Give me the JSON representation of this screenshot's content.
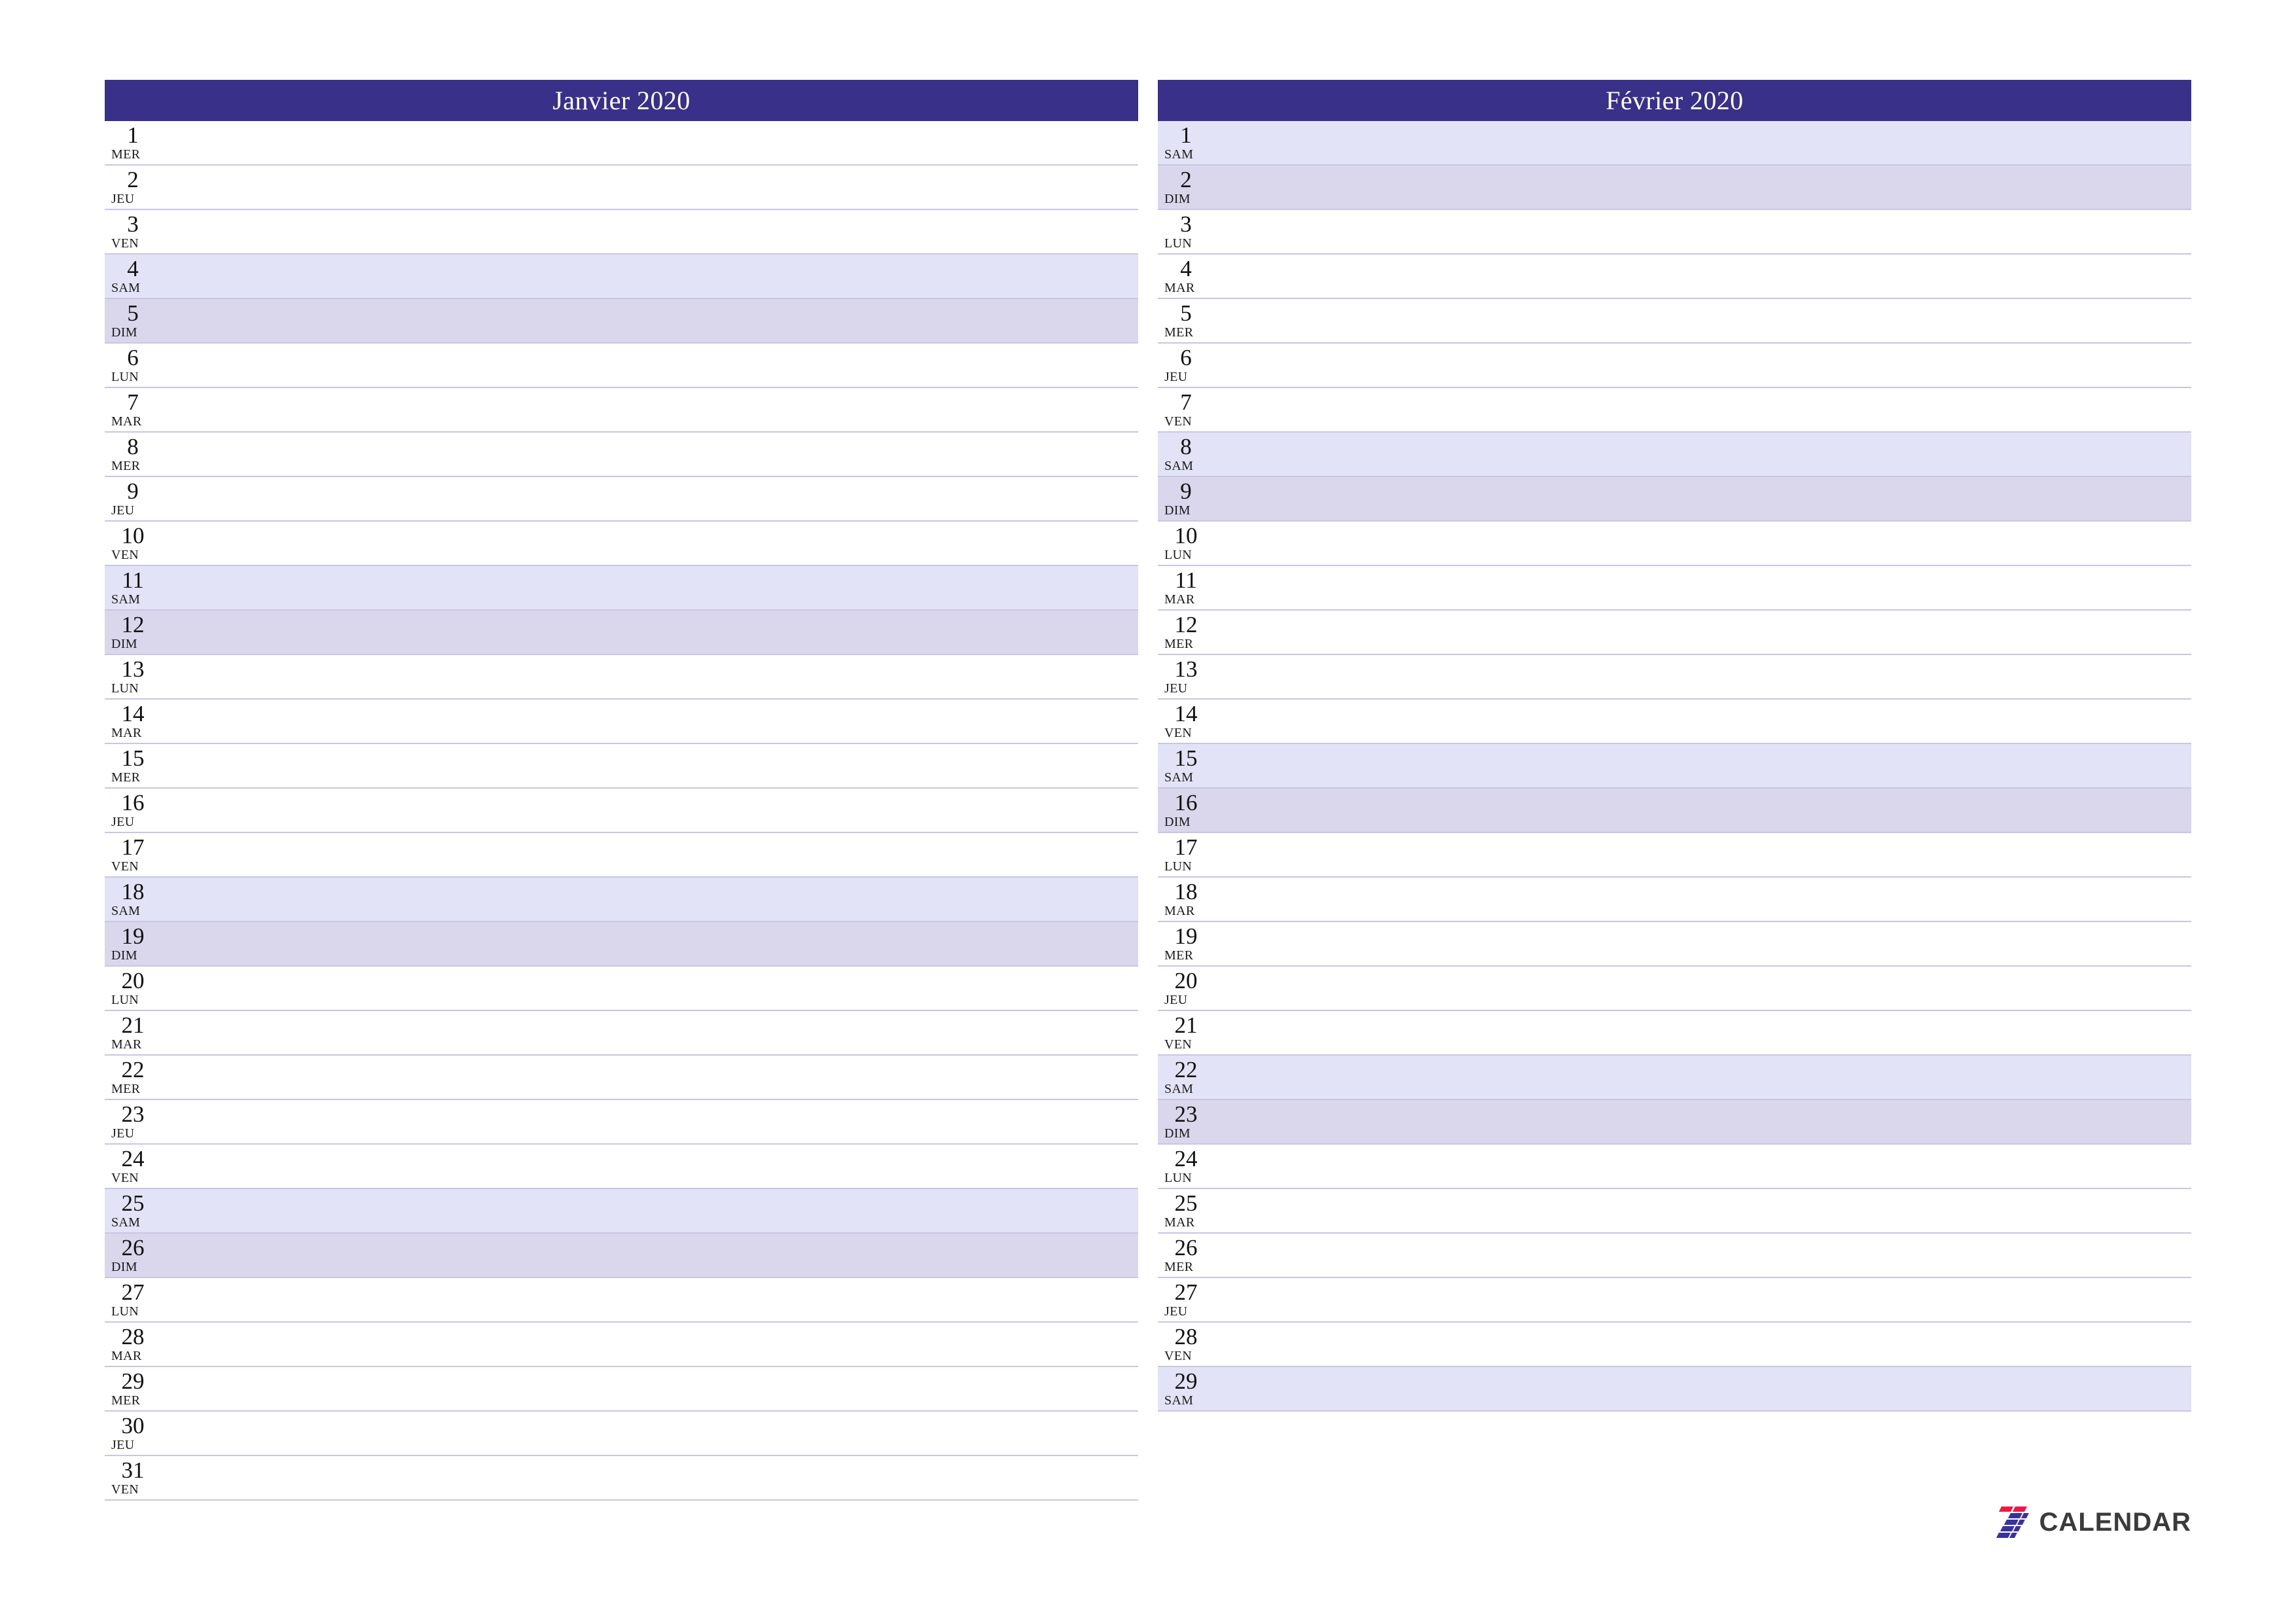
{
  "document": {
    "type": "monthly-planner",
    "orientation": "landscape",
    "language": "fr"
  },
  "colors": {
    "header_bg": "#393089",
    "header_text": "#ffffff",
    "saturday_bg": "#e3e3f7",
    "sunday_bg": "#dad6ec",
    "row_border": "#c9c6e2",
    "day_text": "#111111",
    "brand_text": "#3b3b3b",
    "brand_red": "#ed1846",
    "brand_blue": "#3a31a0"
  },
  "months": [
    {
      "title": "Janvier 2020",
      "days": [
        {
          "num": "1",
          "weekday": "MER",
          "type": "weekday"
        },
        {
          "num": "2",
          "weekday": "JEU",
          "type": "weekday"
        },
        {
          "num": "3",
          "weekday": "VEN",
          "type": "weekday"
        },
        {
          "num": "4",
          "weekday": "SAM",
          "type": "sat"
        },
        {
          "num": "5",
          "weekday": "DIM",
          "type": "sun"
        },
        {
          "num": "6",
          "weekday": "LUN",
          "type": "weekday"
        },
        {
          "num": "7",
          "weekday": "MAR",
          "type": "weekday"
        },
        {
          "num": "8",
          "weekday": "MER",
          "type": "weekday"
        },
        {
          "num": "9",
          "weekday": "JEU",
          "type": "weekday"
        },
        {
          "num": "10",
          "weekday": "VEN",
          "type": "weekday"
        },
        {
          "num": "11",
          "weekday": "SAM",
          "type": "sat"
        },
        {
          "num": "12",
          "weekday": "DIM",
          "type": "sun"
        },
        {
          "num": "13",
          "weekday": "LUN",
          "type": "weekday"
        },
        {
          "num": "14",
          "weekday": "MAR",
          "type": "weekday"
        },
        {
          "num": "15",
          "weekday": "MER",
          "type": "weekday"
        },
        {
          "num": "16",
          "weekday": "JEU",
          "type": "weekday"
        },
        {
          "num": "17",
          "weekday": "VEN",
          "type": "weekday"
        },
        {
          "num": "18",
          "weekday": "SAM",
          "type": "sat"
        },
        {
          "num": "19",
          "weekday": "DIM",
          "type": "sun"
        },
        {
          "num": "20",
          "weekday": "LUN",
          "type": "weekday"
        },
        {
          "num": "21",
          "weekday": "MAR",
          "type": "weekday"
        },
        {
          "num": "22",
          "weekday": "MER",
          "type": "weekday"
        },
        {
          "num": "23",
          "weekday": "JEU",
          "type": "weekday"
        },
        {
          "num": "24",
          "weekday": "VEN",
          "type": "weekday"
        },
        {
          "num": "25",
          "weekday": "SAM",
          "type": "sat"
        },
        {
          "num": "26",
          "weekday": "DIM",
          "type": "sun"
        },
        {
          "num": "27",
          "weekday": "LUN",
          "type": "weekday"
        },
        {
          "num": "28",
          "weekday": "MAR",
          "type": "weekday"
        },
        {
          "num": "29",
          "weekday": "MER",
          "type": "weekday"
        },
        {
          "num": "30",
          "weekday": "JEU",
          "type": "weekday"
        },
        {
          "num": "31",
          "weekday": "VEN",
          "type": "weekday"
        }
      ]
    },
    {
      "title": "Février 2020",
      "days": [
        {
          "num": "1",
          "weekday": "SAM",
          "type": "sat"
        },
        {
          "num": "2",
          "weekday": "DIM",
          "type": "sun"
        },
        {
          "num": "3",
          "weekday": "LUN",
          "type": "weekday"
        },
        {
          "num": "4",
          "weekday": "MAR",
          "type": "weekday"
        },
        {
          "num": "5",
          "weekday": "MER",
          "type": "weekday"
        },
        {
          "num": "6",
          "weekday": "JEU",
          "type": "weekday"
        },
        {
          "num": "7",
          "weekday": "VEN",
          "type": "weekday"
        },
        {
          "num": "8",
          "weekday": "SAM",
          "type": "sat"
        },
        {
          "num": "9",
          "weekday": "DIM",
          "type": "sun"
        },
        {
          "num": "10",
          "weekday": "LUN",
          "type": "weekday"
        },
        {
          "num": "11",
          "weekday": "MAR",
          "type": "weekday"
        },
        {
          "num": "12",
          "weekday": "MER",
          "type": "weekday"
        },
        {
          "num": "13",
          "weekday": "JEU",
          "type": "weekday"
        },
        {
          "num": "14",
          "weekday": "VEN",
          "type": "weekday"
        },
        {
          "num": "15",
          "weekday": "SAM",
          "type": "sat"
        },
        {
          "num": "16",
          "weekday": "DIM",
          "type": "sun"
        },
        {
          "num": "17",
          "weekday": "LUN",
          "type": "weekday"
        },
        {
          "num": "18",
          "weekday": "MAR",
          "type": "weekday"
        },
        {
          "num": "19",
          "weekday": "MER",
          "type": "weekday"
        },
        {
          "num": "20",
          "weekday": "JEU",
          "type": "weekday"
        },
        {
          "num": "21",
          "weekday": "VEN",
          "type": "weekday"
        },
        {
          "num": "22",
          "weekday": "SAM",
          "type": "sat"
        },
        {
          "num": "23",
          "weekday": "DIM",
          "type": "sun"
        },
        {
          "num": "24",
          "weekday": "LUN",
          "type": "weekday"
        },
        {
          "num": "25",
          "weekday": "MAR",
          "type": "weekday"
        },
        {
          "num": "26",
          "weekday": "MER",
          "type": "weekday"
        },
        {
          "num": "27",
          "weekday": "JEU",
          "type": "weekday"
        },
        {
          "num": "28",
          "weekday": "VEN",
          "type": "weekday"
        },
        {
          "num": "29",
          "weekday": "SAM",
          "type": "sat"
        }
      ]
    }
  ],
  "brand": {
    "mark": "seven-stripes-icon",
    "name": "CALENDAR"
  }
}
